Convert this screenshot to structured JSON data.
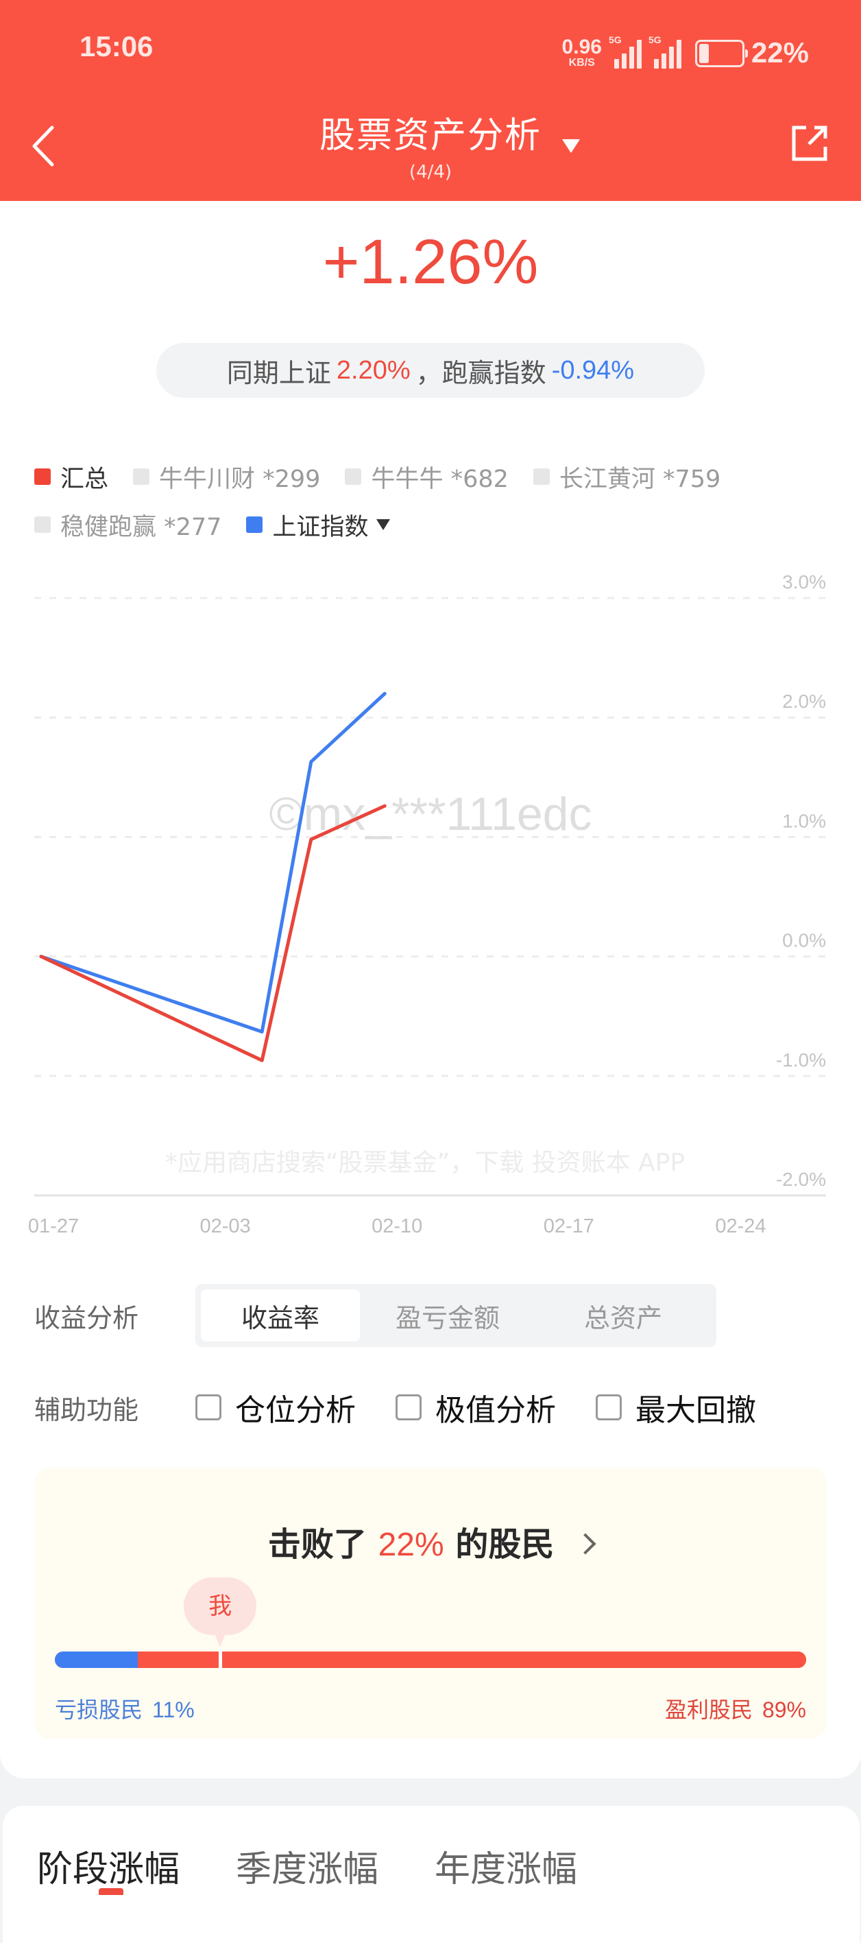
{
  "status_bar": {
    "time": "15:06",
    "net_speed_value": "0.96",
    "net_speed_unit": "KB/S",
    "signal_1_label": "5G",
    "signal_2_label": "5G",
    "battery_level": 0.22,
    "battery_text": "22%"
  },
  "header": {
    "title": "股票资产分析",
    "subtitle": "(4/4)",
    "back_icon": "chevron-left-icon",
    "share_icon": "share-icon",
    "dropdown_icon": "caret-down-icon"
  },
  "summary": {
    "return_pct": "+1.26%",
    "compare_prefix": "同期上证",
    "index_return": "2.20%",
    "compare_mid": "，跑赢指数",
    "excess_return": "-0.94%"
  },
  "legend": {
    "items": [
      {
        "label": "汇总",
        "color": "#f04437",
        "active": true
      },
      {
        "label": "牛牛川财 *299",
        "color": "#e6e6e6",
        "active": false
      },
      {
        "label": "牛牛牛 *682",
        "color": "#e6e6e6",
        "active": false
      },
      {
        "label": "长江黄河 *759",
        "color": "#e6e6e6",
        "active": false
      },
      {
        "label": "稳健跑赢 *277",
        "color": "#e6e6e6",
        "active": false
      },
      {
        "label": "上证指数",
        "color": "#3f7ef0",
        "active": true,
        "dropdown": true
      }
    ]
  },
  "chart_data": {
    "type": "line",
    "title": "",
    "xlabel": "",
    "ylabel": "",
    "x_tick_labels": [
      "01-27",
      "02-03",
      "02-10",
      "02-17",
      "02-24"
    ],
    "x_range_days": [
      "01-27",
      "03-01"
    ],
    "y_tick_labels": [
      "3.0%",
      "2.0%",
      "1.0%",
      "0.0%",
      "-1.0%",
      "-2.0%"
    ],
    "ylim": [
      -2.0,
      3.0
    ],
    "grid": true,
    "legend_position": "top-left",
    "x": [
      "01-27",
      "02-05",
      "02-07",
      "02-10"
    ],
    "series": [
      {
        "name": "汇总",
        "color": "#e8453a",
        "values": [
          0.0,
          -0.87,
          0.98,
          1.26
        ]
      },
      {
        "name": "上证指数",
        "color": "#3f7ef0",
        "values": [
          0.0,
          -0.63,
          1.63,
          2.2
        ]
      }
    ],
    "watermark": "©mx_***111edc",
    "footer_note": "*应用商店搜索“股票基金”，下载 投资账本 APP"
  },
  "analysis": {
    "label": "收益分析",
    "options": [
      "收益率",
      "盈亏金额",
      "总资产"
    ],
    "selected": 0
  },
  "aux": {
    "label": "辅助功能",
    "options": [
      {
        "label": "仓位分析",
        "checked": false
      },
      {
        "label": "极值分析",
        "checked": false
      },
      {
        "label": "最大回撤",
        "checked": false
      }
    ]
  },
  "rank": {
    "prefix": "击败了",
    "percent": "22%",
    "suffix": "的股民",
    "me_label": "我",
    "me_position": 0.22,
    "loss_label": "亏损股民",
    "loss_pct": "11%",
    "loss_share": 0.11,
    "gain_label": "盈利股民",
    "gain_pct": "89%",
    "gain_share": 0.89
  },
  "period_tabs": {
    "items": [
      "阶段涨幅",
      "季度涨幅",
      "年度涨幅"
    ],
    "active": 0
  }
}
